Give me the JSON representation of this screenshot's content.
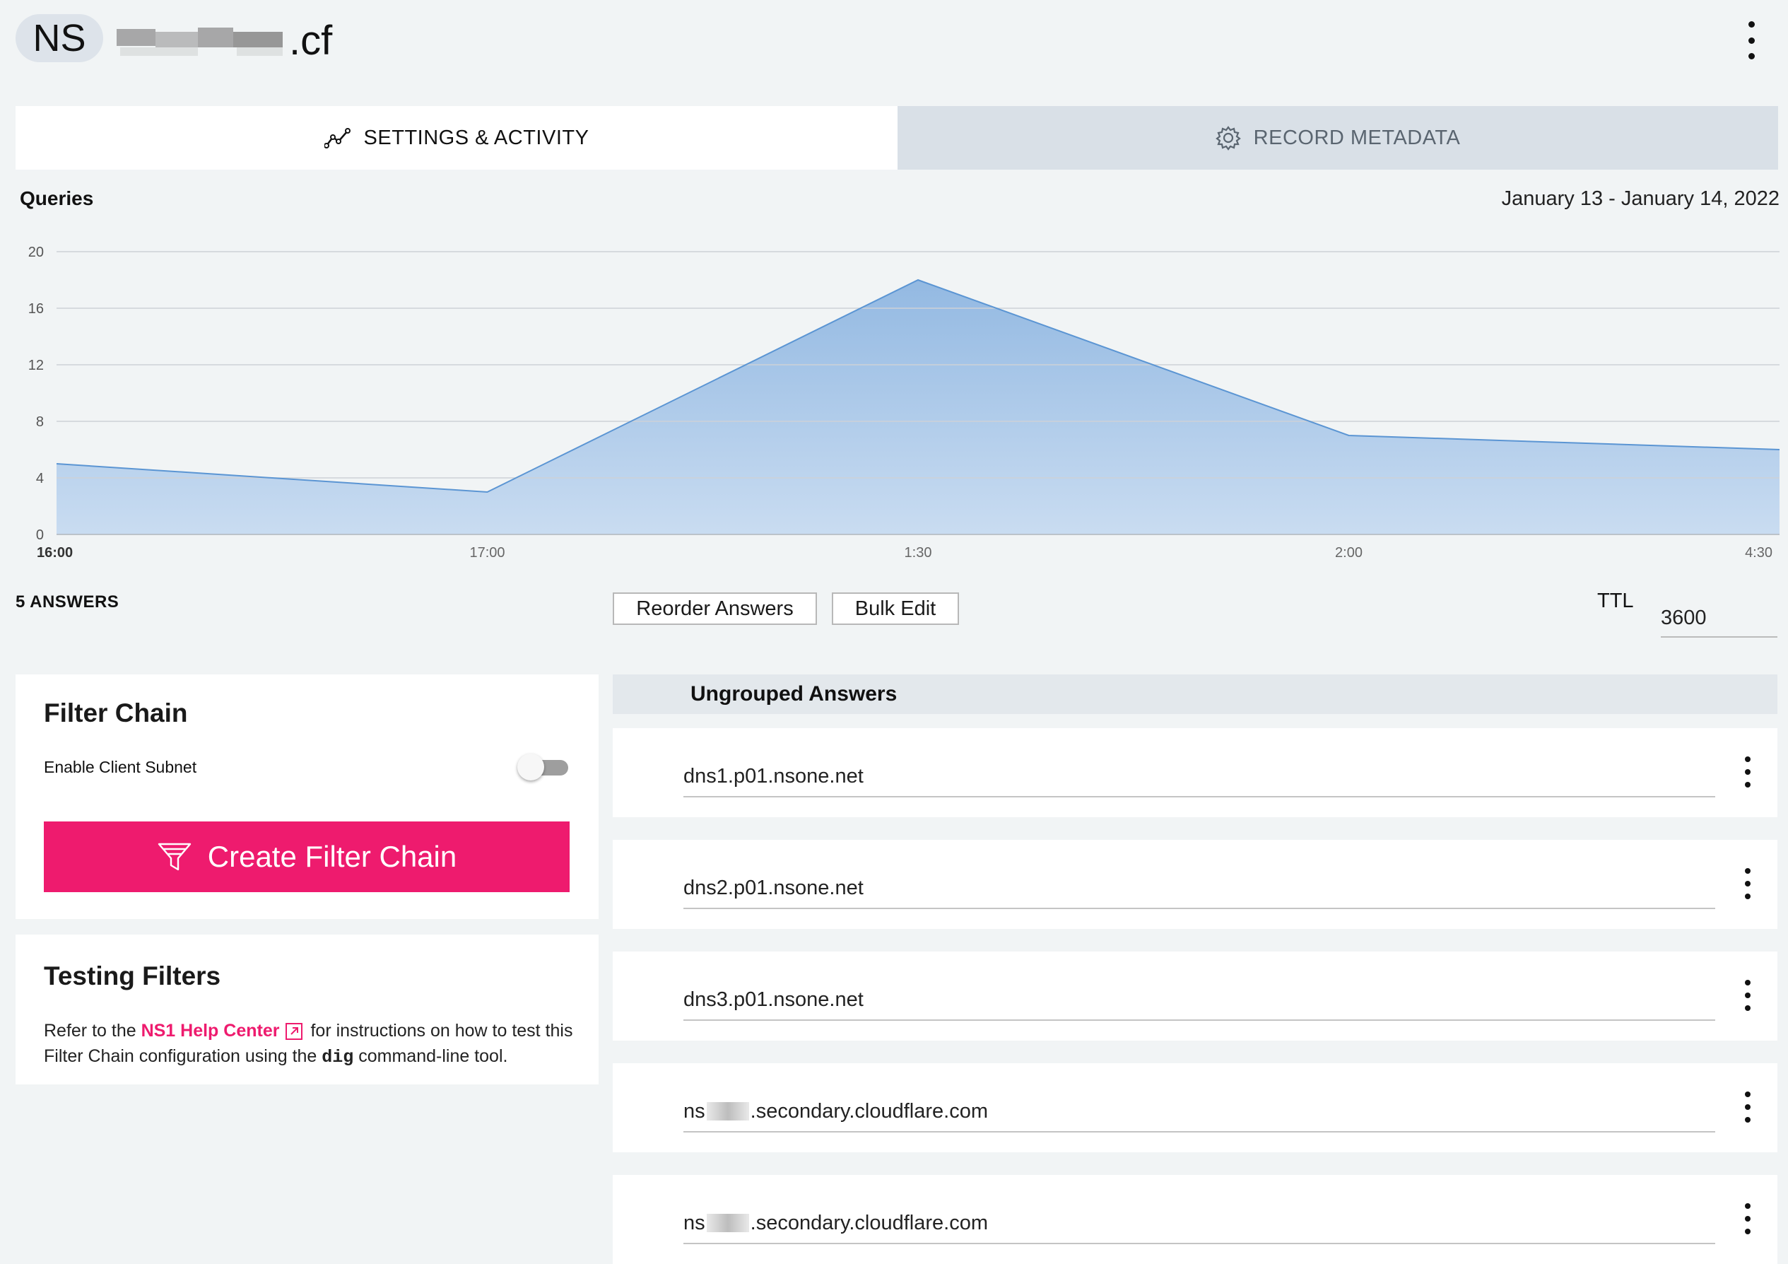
{
  "header": {
    "record_type": "NS",
    "domain_suffix": ".cf",
    "menu_icon": "kebab-menu-icon"
  },
  "tabs": [
    {
      "label": "SETTINGS & ACTIVITY",
      "icon": "activity-chart-icon",
      "active": true
    },
    {
      "label": "RECORD METADATA",
      "icon": "gear-icon",
      "active": false
    }
  ],
  "chart": {
    "title": "Queries",
    "date_range": "January 13 - January 14, 2022"
  },
  "chart_data": {
    "type": "area",
    "x": [
      "16:00",
      "17:00",
      "1:30",
      "2:00",
      "4:30"
    ],
    "values": [
      5,
      3,
      18,
      7,
      6
    ],
    "ylim": [
      0,
      20
    ],
    "yticks": [
      0,
      4,
      8,
      12,
      16,
      20
    ],
    "grid": true,
    "fill_color": "#a9c6e8",
    "line_color": "#5b95d3"
  },
  "answers_bar": {
    "count_label": "5 ANSWERS",
    "reorder_label": "Reorder Answers",
    "bulk_edit_label": "Bulk Edit",
    "ttl_label": "TTL",
    "ttl_value": "3600"
  },
  "filter_chain": {
    "title": "Filter Chain",
    "enable_subnet_label": "Enable Client Subnet",
    "enable_subnet_on": false,
    "create_button_label": "Create Filter Chain",
    "create_button_icon": "funnel-icon",
    "accent_color": "#ee1b6e"
  },
  "testing_filters": {
    "title": "Testing Filters",
    "text_before": "Refer to the ",
    "link_text": "NS1 Help Center",
    "text_after": "for instructions on how to test this Filter Chain configuration using the ",
    "code_text": "dig",
    "text_end": " command-line tool."
  },
  "answers": {
    "group_title": "Ungrouped Answers",
    "items": [
      {
        "value": "dns1.p01.nsone.net"
      },
      {
        "value": "dns2.p01.nsone.net"
      },
      {
        "value": "dns3.p01.nsone.net"
      },
      {
        "prefix": "ns",
        "value": ".secondary.cloudflare.com"
      },
      {
        "prefix": "ns",
        "value": ".secondary.cloudflare.com"
      }
    ]
  }
}
